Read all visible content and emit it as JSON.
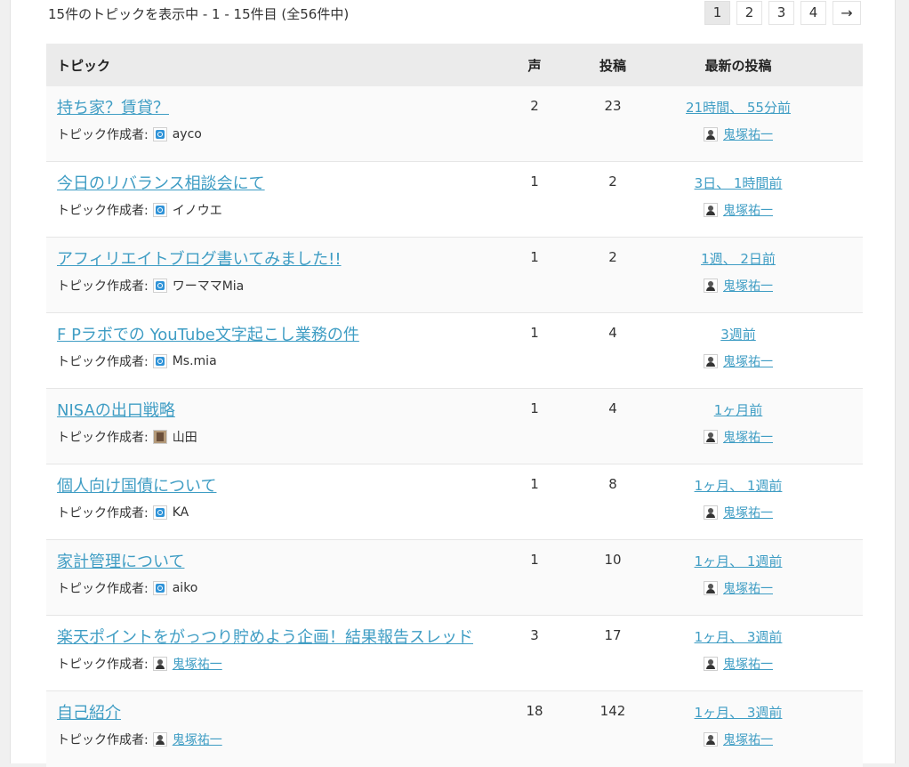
{
  "pagination": {
    "count_text": "15件のトピックを表示中 - 1 - 15件目 (全56件中)",
    "pages": [
      "1",
      "2",
      "3",
      "4"
    ],
    "current": "1",
    "next_label": "→"
  },
  "table": {
    "headers": {
      "topic": "トピック",
      "voices": "声",
      "posts": "投稿",
      "freshness": "最新の投稿"
    },
    "starter_label": "トピック作成者:",
    "rows": [
      {
        "title": "持ち家？賃貸？",
        "starter": "ayco",
        "starter_avatar": "default-avatar-icon",
        "starter_link": false,
        "voices": "2",
        "posts": "23",
        "fresh_time": "21時間、 55分前",
        "fresh_author": "鬼塚祐一"
      },
      {
        "title": "今日のリバランス相談会にて",
        "starter": "イノウエ",
        "starter_avatar": "default-avatar-icon",
        "starter_link": false,
        "voices": "1",
        "posts": "2",
        "fresh_time": "3日、 1時間前",
        "fresh_author": "鬼塚祐一"
      },
      {
        "title": "アフィリエイトブログ書いてみました!!",
        "starter": "ワーママMia",
        "starter_avatar": "default-avatar-icon",
        "starter_link": false,
        "voices": "1",
        "posts": "2",
        "fresh_time": "1週、 2日前",
        "fresh_author": "鬼塚祐一"
      },
      {
        "title": "F Pラボでの YouTube文字起こし業務の件",
        "starter": "Ms.mia",
        "starter_avatar": "default-avatar-icon",
        "starter_link": false,
        "voices": "1",
        "posts": "4",
        "fresh_time": "3週前",
        "fresh_author": "鬼塚祐一"
      },
      {
        "title": "NISAの出口戦略",
        "starter": "山田",
        "starter_avatar": "photo-avatar-icon",
        "starter_link": false,
        "voices": "1",
        "posts": "4",
        "fresh_time": "1ヶ月前",
        "fresh_author": "鬼塚祐一"
      },
      {
        "title": "個人向け国債について",
        "starter": "KA",
        "starter_avatar": "default-avatar-icon",
        "starter_link": false,
        "voices": "1",
        "posts": "8",
        "fresh_time": "1ヶ月、 1週前",
        "fresh_author": "鬼塚祐一"
      },
      {
        "title": "家計管理について",
        "starter": "aiko",
        "starter_avatar": "default-avatar-icon",
        "starter_link": false,
        "voices": "1",
        "posts": "10",
        "fresh_time": "1ヶ月、 1週前",
        "fresh_author": "鬼塚祐一"
      },
      {
        "title": "楽天ポイントをがっつり貯めよう企画！結果報告スレッド",
        "starter": "鬼塚祐一",
        "starter_avatar": "person-avatar-icon",
        "starter_link": true,
        "voices": "3",
        "posts": "17",
        "fresh_time": "1ヶ月、 3週前",
        "fresh_author": "鬼塚祐一"
      },
      {
        "title": "自己紹介",
        "starter": "鬼塚祐一",
        "starter_avatar": "person-avatar-icon",
        "starter_link": true,
        "voices": "18",
        "posts": "142",
        "fresh_time": "1ヶ月、 3週前",
        "fresh_author": "鬼塚祐一"
      }
    ]
  }
}
